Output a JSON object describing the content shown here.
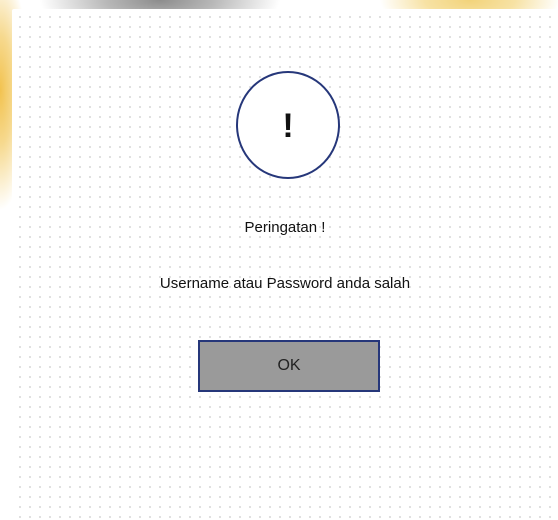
{
  "dialog": {
    "icon": "exclamation-circle-icon",
    "icon_glyph": "!",
    "title": "Peringatan !",
    "message": "Username atau Password anda salah",
    "ok_label": "OK"
  },
  "colors": {
    "accent_border": "#26377a",
    "button_fill": "#9a9a9a"
  }
}
